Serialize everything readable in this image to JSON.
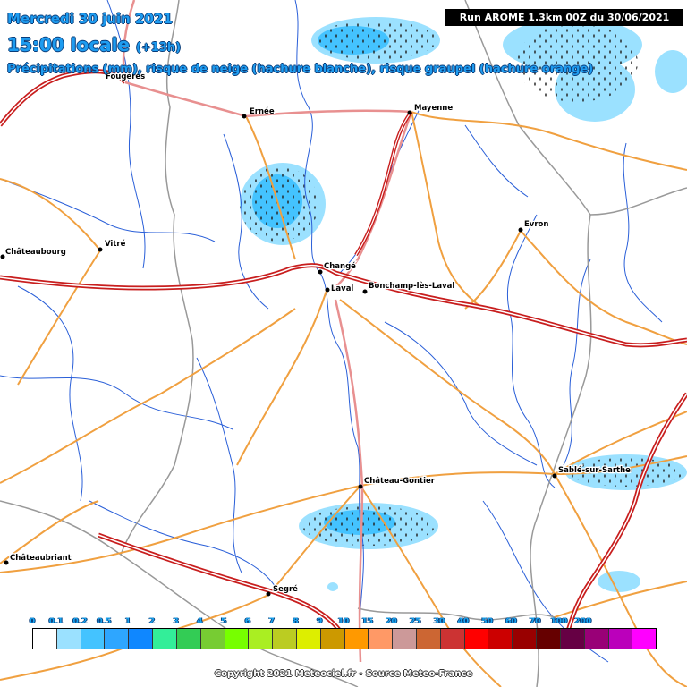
{
  "header": {
    "date": "Mercredi 30 juin 2021",
    "time": "15:00 locale",
    "offset": "(+13h)",
    "subtitle": "Précipitations (mm), risque de neige (hachure blanche), risque graupel (hachure orange)",
    "run": "Run AROME 1.3km 00Z du 30/06/2021"
  },
  "cities": [
    "Fougères",
    "Ernée",
    "Mayenne",
    "Evron",
    "Châteaubourg",
    "Vitré",
    "Changé",
    "Laval",
    "Bonchamp-lès-Laval",
    "Château-Gontier",
    "Sablé-sur-Sarthe",
    "Châteaubriant",
    "Segré"
  ],
  "legend": {
    "ticks": [
      "0",
      "0.1",
      "0.2",
      "0.5",
      "1",
      "2",
      "3",
      "4",
      "5",
      "6",
      "7",
      "8",
      "9",
      "10",
      "15",
      "20",
      "25",
      "30",
      "40",
      "50",
      "60",
      "70",
      "100",
      "200"
    ],
    "colors": [
      "#ffffff",
      "#9be1ff",
      "#44c3ff",
      "#2ea6ff",
      "#0f87ff",
      "#33ee99",
      "#33cc55",
      "#77cc33",
      "#77ff00",
      "#aaee22",
      "#bbcc22",
      "#ddee00",
      "#cc9900",
      "#ff9900",
      "#ff9966",
      "#cc9999",
      "#cc6633",
      "#cc3333",
      "#ff0000",
      "#cc0000",
      "#990000",
      "#660000",
      "#660044",
      "#990077",
      "#bb00bb",
      "#ff00ff"
    ]
  },
  "copyright": "Copyright 2021 Meteociel.fr - Source Meteo-France"
}
